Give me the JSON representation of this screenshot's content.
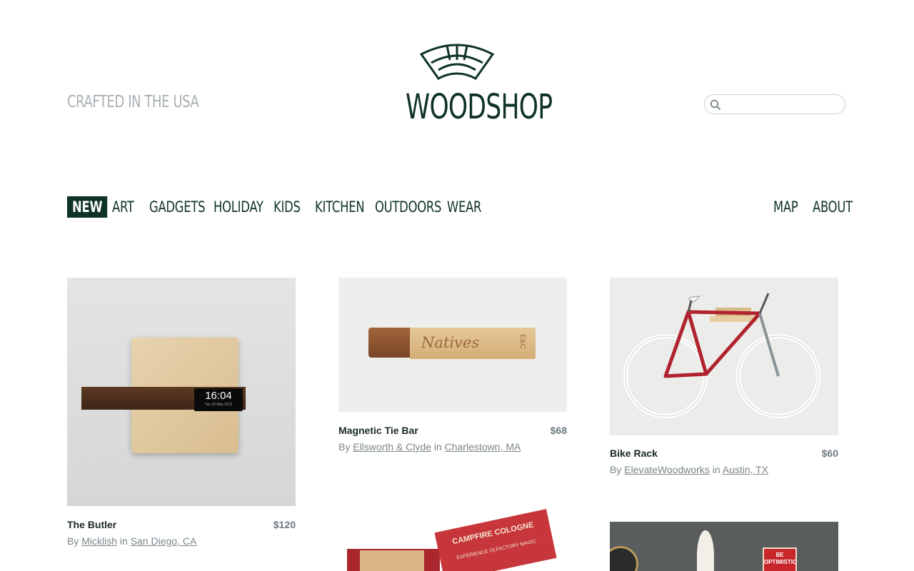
{
  "header": {
    "tagline": "CRAFTED IN THE USA",
    "brand": "WOODSHOP",
    "search": {
      "placeholder": "",
      "value": ""
    }
  },
  "nav": {
    "left": [
      "NEW",
      "ART",
      "GADGETS",
      "HOLIDAY",
      "KIDS",
      "KITCHEN",
      "OUTDOORS",
      "WEAR"
    ],
    "right": [
      "MAP",
      "ABOUT"
    ],
    "active": "NEW"
  },
  "products": [
    {
      "name": "The Butler",
      "price": "$120",
      "by_prefix": "By",
      "maker": "Micklish",
      "in_word": "in",
      "location": "San Diego, CA",
      "image_text": "16:04",
      "image_subtext": "Tue 29 May 2012"
    },
    {
      "name": "Magnetic Tie Bar",
      "price": "$68",
      "by_prefix": "By",
      "maker": "Ellsworth & Clyde",
      "in_word": "in",
      "location": "Charlestown, MA",
      "image_text": "Natives",
      "image_subtext": "E&C"
    },
    {
      "name": "Bike Rack",
      "price": "$60",
      "by_prefix": "By",
      "maker": "ElevateWoodworks",
      "in_word": "in",
      "location": "Austin, TX"
    },
    {
      "image_text": "CAMPFIRE COLOGNE",
      "image_subtext": "EXPERIENCE OLFACTORY MAGIC"
    },
    {
      "image_text": "BE OPTIMISTIC"
    }
  ],
  "colors": {
    "brand_green": "#0f3324",
    "muted_gray": "#a9b0b4",
    "price_gray": "#6c7a80"
  }
}
